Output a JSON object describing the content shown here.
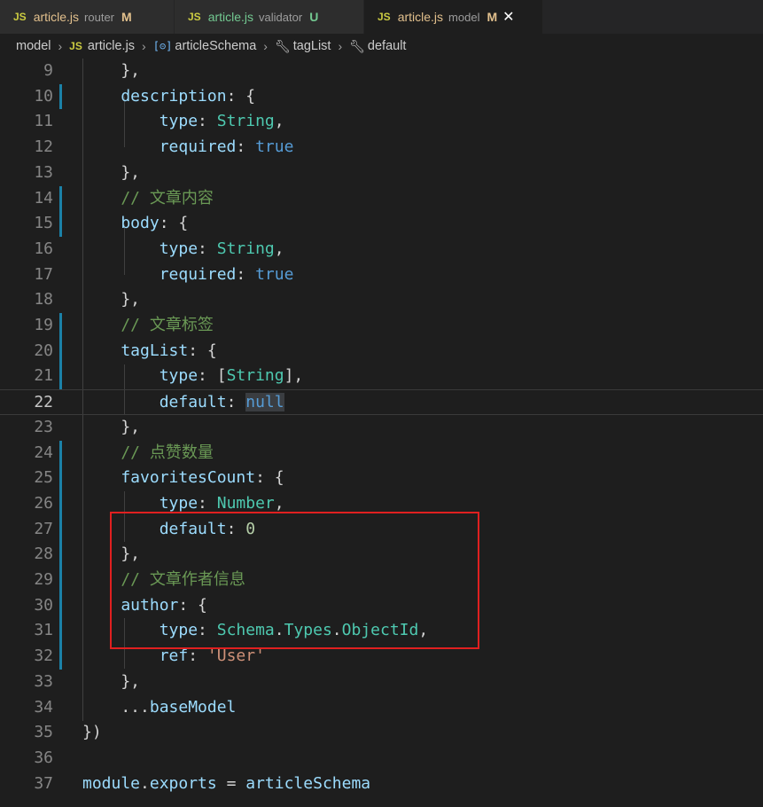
{
  "tabs": [
    {
      "icon": "JS",
      "name": "article.js",
      "desc": "router",
      "status": "M"
    },
    {
      "icon": "JS",
      "name": "article.js",
      "desc": "validator",
      "status": "U"
    },
    {
      "icon": "JS",
      "name": "article.js",
      "desc": "model",
      "status": "M",
      "close": "✕"
    }
  ],
  "breadcrumb": {
    "folder": "model",
    "file_icon": "JS",
    "file": "article.js",
    "obj_icon": "[⊝]",
    "symbol1": "articleSchema",
    "symbol2": "tagList",
    "symbol3": "default",
    "sep": "›"
  },
  "lines": [
    {
      "num": "9",
      "t": [
        [
          "p",
          "        },"
        ]
      ]
    },
    {
      "num": "10",
      "t": [
        [
          "k",
          "        description"
        ],
        [
          "p",
          ": {"
        ]
      ]
    },
    {
      "num": "11",
      "t": [
        [
          "k",
          "            type"
        ],
        [
          "p",
          ": "
        ],
        [
          "t",
          "String"
        ],
        [
          "p",
          ","
        ]
      ]
    },
    {
      "num": "12",
      "t": [
        [
          "k",
          "            required"
        ],
        [
          "p",
          ": "
        ],
        [
          "b",
          "true"
        ]
      ]
    },
    {
      "num": "13",
      "t": [
        [
          "p",
          "        },"
        ]
      ]
    },
    {
      "num": "14",
      "t": [
        [
          "c",
          "        // 文章内容"
        ]
      ]
    },
    {
      "num": "15",
      "t": [
        [
          "k",
          "        body"
        ],
        [
          "p",
          ": {"
        ]
      ]
    },
    {
      "num": "16",
      "t": [
        [
          "k",
          "            type"
        ],
        [
          "p",
          ": "
        ],
        [
          "t",
          "String"
        ],
        [
          "p",
          ","
        ]
      ]
    },
    {
      "num": "17",
      "t": [
        [
          "k",
          "            required"
        ],
        [
          "p",
          ": "
        ],
        [
          "b",
          "true"
        ]
      ]
    },
    {
      "num": "18",
      "t": [
        [
          "p",
          "        },"
        ]
      ]
    },
    {
      "num": "19",
      "t": [
        [
          "c",
          "        // 文章标签"
        ]
      ]
    },
    {
      "num": "20",
      "t": [
        [
          "k",
          "        tagList"
        ],
        [
          "p",
          ": {"
        ]
      ]
    },
    {
      "num": "21",
      "t": [
        [
          "k",
          "            type"
        ],
        [
          "p",
          ": ["
        ],
        [
          "t",
          "String"
        ],
        [
          "p",
          "],"
        ]
      ]
    },
    {
      "num": "22",
      "t": [
        [
          "k",
          "            default"
        ],
        [
          "p",
          ": "
        ],
        [
          "b",
          "null"
        ]
      ]
    },
    {
      "num": "23",
      "t": [
        [
          "p",
          "        },"
        ]
      ]
    },
    {
      "num": "24",
      "t": [
        [
          "c",
          "        // 点赞数量"
        ]
      ]
    },
    {
      "num": "25",
      "t": [
        [
          "k",
          "        favoritesCount"
        ],
        [
          "p",
          ": {"
        ]
      ]
    },
    {
      "num": "26",
      "t": [
        [
          "k",
          "            type"
        ],
        [
          "p",
          ": "
        ],
        [
          "t",
          "Number"
        ],
        [
          "p",
          ","
        ]
      ]
    },
    {
      "num": "27",
      "t": [
        [
          "k",
          "            default"
        ],
        [
          "p",
          ": "
        ],
        [
          "n",
          "0"
        ]
      ]
    },
    {
      "num": "28",
      "t": [
        [
          "p",
          "        },"
        ]
      ]
    },
    {
      "num": "29",
      "t": [
        [
          "c",
          "        // 文章作者信息"
        ]
      ]
    },
    {
      "num": "30",
      "t": [
        [
          "k",
          "        author"
        ],
        [
          "p",
          ": {"
        ]
      ]
    },
    {
      "num": "31",
      "t": [
        [
          "k",
          "            type"
        ],
        [
          "p",
          ": "
        ],
        [
          "t",
          "Schema"
        ],
        [
          "p",
          "."
        ],
        [
          "t",
          "Types"
        ],
        [
          "p",
          "."
        ],
        [
          "t",
          "ObjectId"
        ],
        [
          "p",
          ","
        ]
      ]
    },
    {
      "num": "32",
      "t": [
        [
          "k",
          "            ref"
        ],
        [
          "p",
          ": "
        ],
        [
          "s",
          "'User'"
        ]
      ]
    },
    {
      "num": "33",
      "t": [
        [
          "p",
          "        },"
        ]
      ]
    },
    {
      "num": "34",
      "t": [
        [
          "p",
          "        ..."
        ],
        [
          "k",
          "baseModel"
        ]
      ]
    },
    {
      "num": "35",
      "t": [
        [
          "p",
          "    })"
        ]
      ]
    },
    {
      "num": "36",
      "t": []
    },
    {
      "num": "37",
      "t": [
        [
          "k",
          "    module"
        ],
        [
          "p",
          "."
        ],
        [
          "k",
          "exports"
        ],
        [
          "p",
          " = "
        ],
        [
          "k",
          "articleSchema"
        ]
      ]
    }
  ],
  "current_line": "22",
  "modified_lines": [
    "10",
    "14",
    "15",
    "19",
    "20",
    "21",
    "24",
    "25",
    "26",
    "27",
    "28",
    "29",
    "30",
    "31",
    "32"
  ],
  "colors": {
    "annotation_box": "#e02020",
    "gutter_modified": "#1b81a8"
  }
}
